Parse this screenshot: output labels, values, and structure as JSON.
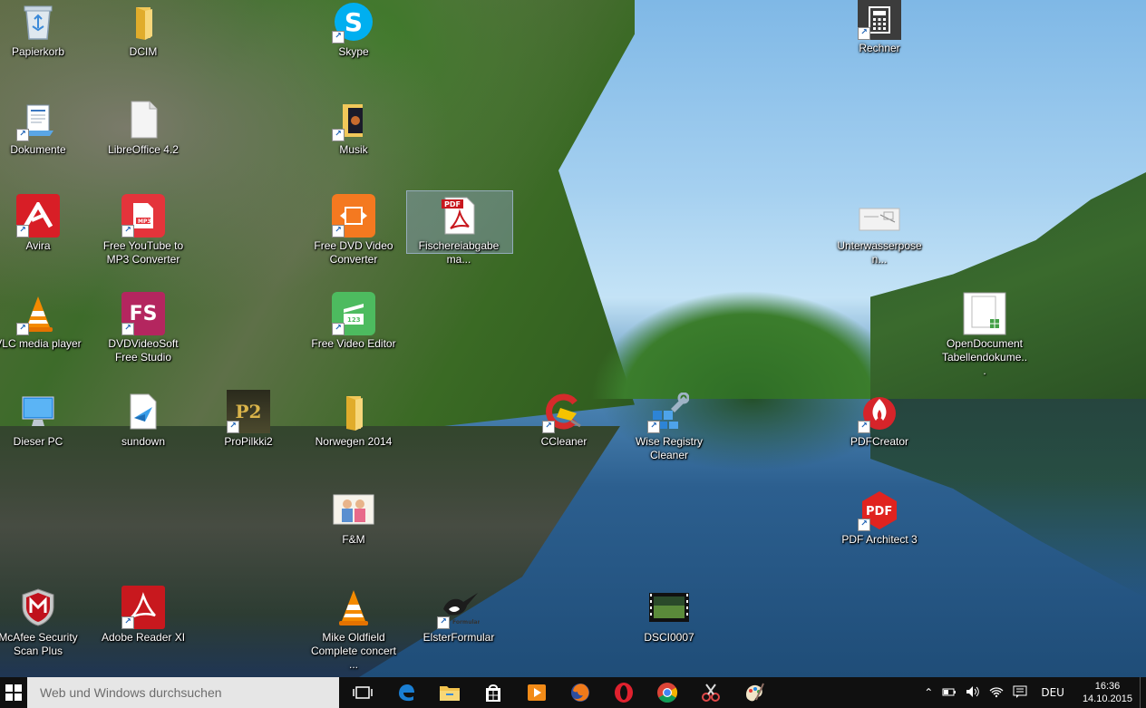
{
  "desktop": {
    "icons": [
      {
        "label": "Papierkorb",
        "icon": "recycle-bin-icon"
      },
      {
        "label": "DCIM",
        "icon": "folder-icon"
      },
      {
        "label": "Skype",
        "icon": "skype-icon"
      },
      {
        "label": "Rechner",
        "icon": "calculator-icon"
      },
      {
        "label": "Dokumente",
        "icon": "documents-icon"
      },
      {
        "label": "LibreOffice 4.2",
        "icon": "libreoffice-icon"
      },
      {
        "label": "Musik",
        "icon": "music-folder-icon"
      },
      {
        "label": "Avira",
        "icon": "avira-icon"
      },
      {
        "label": "Free YouTube to MP3 Converter",
        "icon": "youtube-mp3-icon"
      },
      {
        "label": "Free DVD Video Converter",
        "icon": "dvd-converter-icon"
      },
      {
        "label": "Fischereiabgabema...",
        "icon": "pdf-file-icon"
      },
      {
        "label": "Unterwasserposen...",
        "icon": "image-file-icon"
      },
      {
        "label": "VLC media player",
        "icon": "vlc-icon"
      },
      {
        "label": "DVDVideoSoft Free Studio",
        "icon": "dvdvideosoft-icon"
      },
      {
        "label": "Free Video Editor",
        "icon": "video-editor-icon"
      },
      {
        "label": "OpenDocument Tabellendokume...",
        "icon": "spreadsheet-file-icon"
      },
      {
        "label": "Dieser PC",
        "icon": "this-pc-icon"
      },
      {
        "label": "sundown",
        "icon": "sundown-icon"
      },
      {
        "label": "ProPilkki2",
        "icon": "propilkki-icon"
      },
      {
        "label": "Norwegen 2014",
        "icon": "folder-icon"
      },
      {
        "label": "CCleaner",
        "icon": "ccleaner-icon"
      },
      {
        "label": "Wise Registry Cleaner",
        "icon": "wise-registry-icon"
      },
      {
        "label": "PDFCreator",
        "icon": "pdfcreator-icon"
      },
      {
        "label": "F&M",
        "icon": "photo-file-icon"
      },
      {
        "label": "PDF Architect 3",
        "icon": "pdf-architect-icon"
      },
      {
        "label": "McAfee Security Scan Plus",
        "icon": "mcafee-icon"
      },
      {
        "label": "Adobe Reader XI",
        "icon": "adobe-reader-icon"
      },
      {
        "label": "Mike Oldfield Complete concert ...",
        "icon": "vlc-icon"
      },
      {
        "label": "ElsterFormular",
        "icon": "elster-icon"
      },
      {
        "label": "DSCI0007",
        "icon": "video-file-icon"
      }
    ]
  },
  "taskbar": {
    "search_placeholder": "Web und Windows durchsuchen",
    "apps": [
      "task-view-icon",
      "edge-icon",
      "file-explorer-icon",
      "store-icon",
      "media-player-icon",
      "firefox-icon",
      "opera-icon",
      "chrome-icon",
      "snipping-icon",
      "paint-icon"
    ],
    "tray": {
      "language": "DEU",
      "time": "16:36",
      "date": "14.10.2015"
    }
  }
}
